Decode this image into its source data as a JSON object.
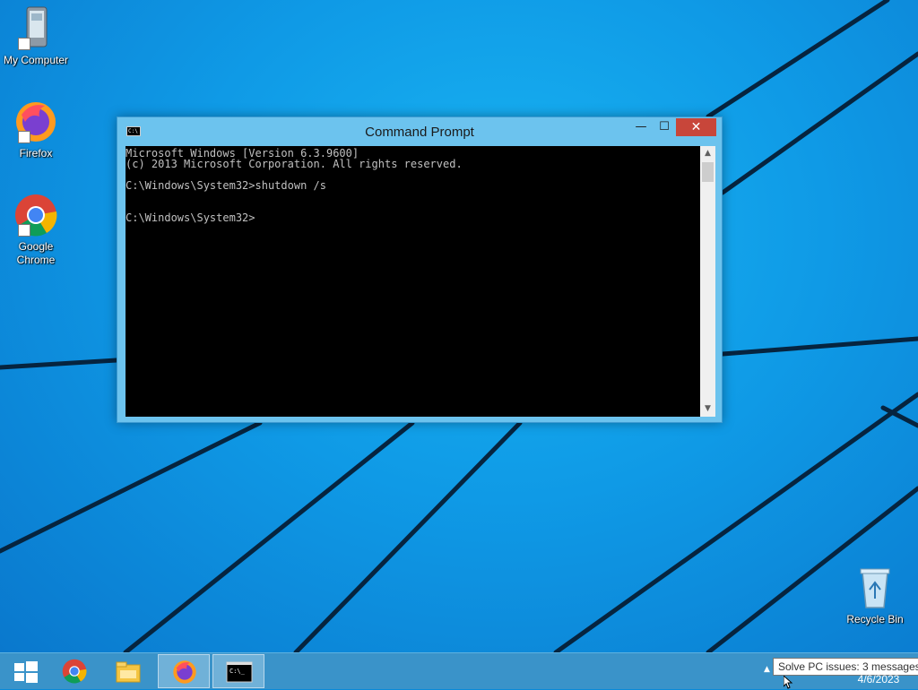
{
  "desktop": {
    "icons": [
      {
        "label": "My Computer",
        "icon": "my-computer-icon"
      },
      {
        "label": "Firefox",
        "icon": "firefox-icon"
      },
      {
        "label": "Google\nChrome",
        "icon": "chrome-icon"
      },
      {
        "label": "Recycle Bin",
        "icon": "recycle-bin-icon"
      }
    ]
  },
  "cmd": {
    "title": "Command Prompt",
    "lines": [
      "Microsoft Windows [Version 6.3.9600]",
      "(c) 2013 Microsoft Corporation. All rights reserved.",
      "",
      "C:\\Windows\\System32>shutdown /s",
      "",
      "",
      "C:\\Windows\\System32>"
    ]
  },
  "taskbar": {
    "buttons": [
      {
        "icon": "windows-start-icon"
      },
      {
        "icon": "chrome-icon"
      },
      {
        "icon": "file-explorer-icon"
      },
      {
        "icon": "firefox-icon"
      },
      {
        "icon": "command-prompt-icon"
      }
    ],
    "tooltip": "Solve PC issues: 3 messages",
    "date": "4/6/2023"
  },
  "colors": {
    "accent": "#0f9ae6",
    "window_frame": "#6cc3ee",
    "close_button": "#c8463a",
    "console_bg": "#000000",
    "console_text": "#c0c0c0"
  }
}
